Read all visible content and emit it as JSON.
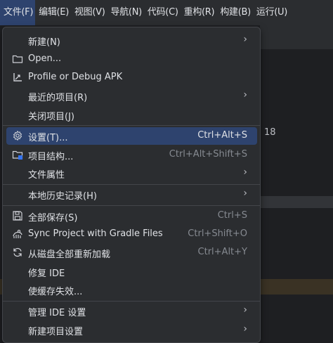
{
  "menubar": [
    {
      "label": "文件(F)",
      "active": true
    },
    {
      "label": "编辑(E)"
    },
    {
      "label": "视图(V)"
    },
    {
      "label": "导航(N)"
    },
    {
      "label": "代码(C)"
    },
    {
      "label": "重构(R)"
    },
    {
      "label": "构建(B)"
    },
    {
      "label": "运行(U)"
    }
  ],
  "background": {
    "text": "18"
  },
  "file_menu": {
    "new": {
      "label": "新建(N)"
    },
    "open": {
      "label": "Open..."
    },
    "profile": {
      "label": "Profile or Debug APK"
    },
    "recent": {
      "label": "最近的项目(R)"
    },
    "close": {
      "label": "关闭项目(J)"
    },
    "settings": {
      "label": "设置(T)...",
      "shortcut": "Ctrl+Alt+S"
    },
    "structure": {
      "label": "项目结构...",
      "shortcut": "Ctrl+Alt+Shift+S"
    },
    "props": {
      "label": "文件属性"
    },
    "history": {
      "label": "本地历史记录(H)"
    },
    "saveall": {
      "label": "全部保存(S)",
      "shortcut": "Ctrl+S"
    },
    "sync": {
      "label": "Sync Project with Gradle Files",
      "shortcut": "Ctrl+Shift+O"
    },
    "reload": {
      "label": "从磁盘全部重新加载",
      "shortcut": "Ctrl+Alt+Y"
    },
    "repair": {
      "label": "修复 IDE"
    },
    "invalidate": {
      "label": "使缓存失效..."
    },
    "manage": {
      "label": "管理 IDE 设置"
    },
    "newproj": {
      "label": "新建项目设置"
    }
  }
}
